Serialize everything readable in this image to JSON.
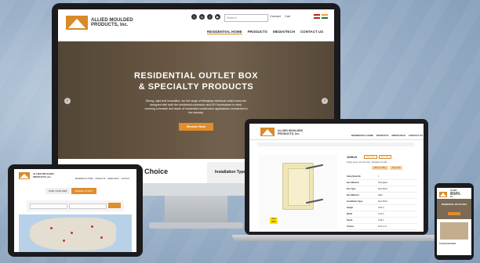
{
  "imac": {
    "logo_text": "ALLIED MOULDED PRODUCTS, Inc.",
    "search_placeholder": "Search",
    "top_links": [
      "Contact",
      "Cart"
    ],
    "nav": [
      "RESIDENTIAL HOME",
      "PRODUCTS",
      "MEDIA/TECH",
      "CONTACT US"
    ],
    "hero_line1": "RESIDENTIAL OUTLET BOX",
    "hero_line2": "& SPECIALTY PRODUCTS",
    "hero_text": "Strong, rigid and innovative, our full range of fiberglass electrical outlet boxes are designed with both the residential contractor and DIY homeowner in mind, covering a breadth and depth of residential construction applications unmatched in the industry.",
    "hero_button": "Browse Now",
    "arrow_left": "‹",
    "arrow_right": "›",
    "section_heading": "The Contractor's Choice",
    "install_label": "Installation Type"
  },
  "laptop": {
    "logo_text": "ALLIED MOULDED PRODUCTS, Inc.",
    "nav": [
      "RESIDENTIAL HOME",
      "PRODUCTS",
      "MEDIA/TECH",
      "CONTACT US"
    ],
    "product_title": "1099-N",
    "product_buttons": [
      "Ask a rep",
      "Spec Sht"
    ],
    "product_desc": "Single gang new work box, fiberglass w/nails",
    "cta_buttons": [
      "Where to Buy",
      "Spec Sht"
    ],
    "tag_text": "New Work",
    "specs": [
      {
        "k": "Gang Quantity",
        "v": "1"
      },
      {
        "k": "Box Material",
        "v": "Fiberglass"
      },
      {
        "k": "Box Type",
        "v": "New Work"
      },
      {
        "k": "Box Material",
        "v": "Nails"
      },
      {
        "k": "Installation Type",
        "v": "New Work"
      },
      {
        "k": "Height",
        "v": "3.81 in"
      },
      {
        "k": "Width",
        "v": "2.25 in"
      },
      {
        "k": "Depth",
        "v": "3.00 in"
      },
      {
        "k": "Volume",
        "v": "22.5 cu in"
      },
      {
        "k": "Number of Gangs",
        "v": "1"
      }
    ]
  },
  "tablet": {
    "logo_text": "ALLIED MOULDED PRODUCTS, Inc.",
    "nav": [
      "RESIDENTIAL HOME",
      "PRODUCTS",
      "MEDIA/TECH",
      "CONTACT"
    ],
    "tabs": [
      "FIND YOUR REP",
      "WHERE TO BUY"
    ]
  },
  "phone": {
    "logo_text": "ALLIED MOULDED PRODUCTS, Inc.",
    "hero_text": "RESIDENTIAL OUTLET BOX",
    "section_text": "Commercial Outlet"
  },
  "colors": {
    "accent": "#e08d2b",
    "dark": "#1b1b1d"
  }
}
